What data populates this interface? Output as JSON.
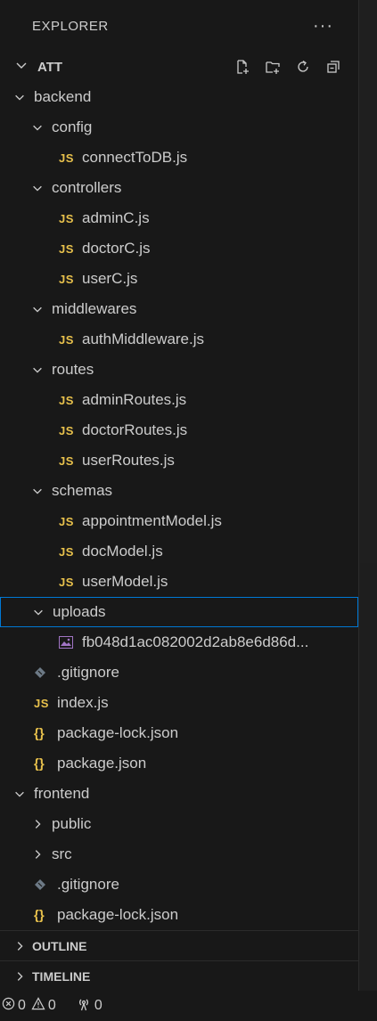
{
  "explorer": {
    "title": "EXPLORER",
    "more_label": "···",
    "root_name": "ATT"
  },
  "tree": [
    {
      "label": "backend",
      "depth": 1,
      "type": "folder",
      "expanded": true
    },
    {
      "label": "config",
      "depth": 2,
      "type": "folder",
      "expanded": true
    },
    {
      "label": "connectToDB.js",
      "depth": 3,
      "type": "js"
    },
    {
      "label": "controllers",
      "depth": 2,
      "type": "folder",
      "expanded": true
    },
    {
      "label": "adminC.js",
      "depth": 3,
      "type": "js"
    },
    {
      "label": "doctorC.js",
      "depth": 3,
      "type": "js"
    },
    {
      "label": "userC.js",
      "depth": 3,
      "type": "js"
    },
    {
      "label": "middlewares",
      "depth": 2,
      "type": "folder",
      "expanded": true
    },
    {
      "label": "authMiddleware.js",
      "depth": 3,
      "type": "js"
    },
    {
      "label": "routes",
      "depth": 2,
      "type": "folder",
      "expanded": true
    },
    {
      "label": "adminRoutes.js",
      "depth": 3,
      "type": "js"
    },
    {
      "label": "doctorRoutes.js",
      "depth": 3,
      "type": "js"
    },
    {
      "label": "userRoutes.js",
      "depth": 3,
      "type": "js"
    },
    {
      "label": "schemas",
      "depth": 2,
      "type": "folder",
      "expanded": true
    },
    {
      "label": "appointmentModel.js",
      "depth": 3,
      "type": "js"
    },
    {
      "label": "docModel.js",
      "depth": 3,
      "type": "js"
    },
    {
      "label": "userModel.js",
      "depth": 3,
      "type": "js"
    },
    {
      "label": "uploads",
      "depth": 2,
      "type": "folder",
      "expanded": true,
      "selected": true
    },
    {
      "label": "fb048d1ac082002d2ab8e6d86d...",
      "depth": 3,
      "type": "image"
    },
    {
      "label": ".gitignore",
      "depth": 2,
      "type": "git"
    },
    {
      "label": "index.js",
      "depth": 2,
      "type": "js"
    },
    {
      "label": "package-lock.json",
      "depth": 2,
      "type": "json"
    },
    {
      "label": "package.json",
      "depth": 2,
      "type": "json"
    },
    {
      "label": "frontend",
      "depth": 1,
      "type": "folder",
      "expanded": true
    },
    {
      "label": "public",
      "depth": 2,
      "type": "folder",
      "expanded": false
    },
    {
      "label": "src",
      "depth": 2,
      "type": "folder",
      "expanded": false
    },
    {
      "label": ".gitignore",
      "depth": 2,
      "type": "git"
    },
    {
      "label": "package-lock.json",
      "depth": 2,
      "type": "json"
    }
  ],
  "icon_text": {
    "js": "JS",
    "json": "{}"
  },
  "sections": {
    "outline": "OUTLINE",
    "timeline": "TIMELINE"
  },
  "status": {
    "errors": "0",
    "warnings": "0",
    "ports": "0"
  },
  "colors": {
    "accent": "#0078d4",
    "js": "#e8c14c",
    "text": "#cccccc",
    "background": "#181818"
  }
}
